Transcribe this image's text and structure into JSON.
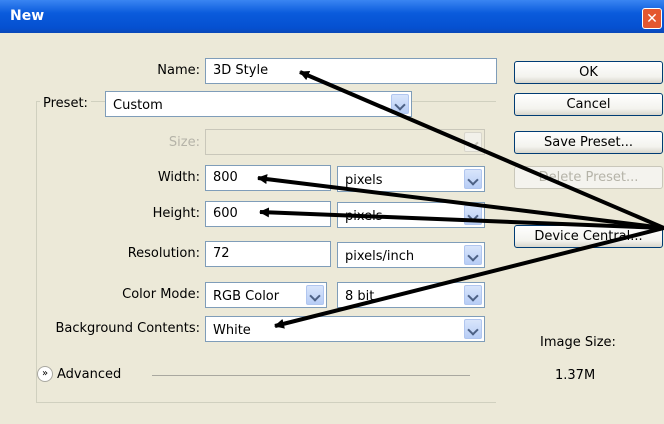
{
  "window": {
    "title": "New",
    "close_glyph": "✕"
  },
  "name_label": "Name:",
  "name_value": "3D Style",
  "preset": {
    "label": "Preset:",
    "value": "Custom"
  },
  "size": {
    "label": "Size:",
    "value": ""
  },
  "width": {
    "label": "Width:",
    "value": "800",
    "unit": "pixels"
  },
  "height": {
    "label": "Height:",
    "value": "600",
    "unit": "pixels"
  },
  "resolution": {
    "label": "Resolution:",
    "value": "72",
    "unit": "pixels/inch"
  },
  "color_mode": {
    "label": "Color Mode:",
    "value": "RGB Color",
    "depth": "8 bit"
  },
  "background": {
    "label": "Background Contents:",
    "value": "White"
  },
  "advanced": {
    "label": "Advanced",
    "icon": "expand-chevrons-icon"
  },
  "buttons": {
    "ok": "OK",
    "cancel": "Cancel",
    "save_preset": "Save Preset...",
    "delete_preset": "Delete Preset...",
    "device_central": "Device Central..."
  },
  "image_size": {
    "label": "Image Size:",
    "value": "1.37M"
  },
  "colors": {
    "titlebar": "#0a5bdc",
    "dialog": "#ece9d8",
    "arrows": "#000000"
  }
}
